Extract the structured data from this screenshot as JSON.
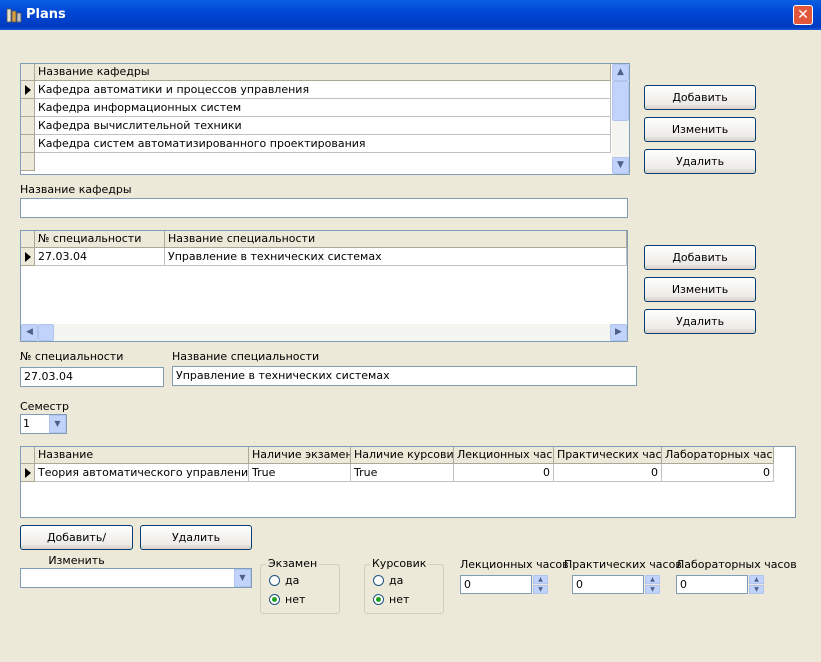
{
  "window": {
    "title": "Plans"
  },
  "departments_grid": {
    "column_header": "Название кафедры",
    "rows": [
      "Кафедра автоматики и процессов управления",
      "Кафедра информационных систем",
      "Кафедра вычислительной техники",
      "Кафедра систем автоматизированного проектирования"
    ]
  },
  "dept_buttons": {
    "add": "Добавить",
    "edit": "Изменить",
    "delete": "Удалить"
  },
  "dept_name": {
    "label": "Название кафедры",
    "value": ""
  },
  "specialties_grid": {
    "headers": [
      "№ специальности",
      "Название специальности"
    ],
    "rows": [
      [
        "27.03.04",
        "Управление в технических системах"
      ]
    ]
  },
  "spec_buttons": {
    "add": "Добавить",
    "edit": "Изменить",
    "delete": "Удалить"
  },
  "spec_number": {
    "label": "№ специальности",
    "value": "27.03.04"
  },
  "spec_name": {
    "label": "Название специальности",
    "value": "Управление в технических системах"
  },
  "semester": {
    "label": "Семестр",
    "value": "1"
  },
  "subjects_grid": {
    "headers": [
      "Название",
      "Наличие экзамена",
      "Наличие курсовика",
      "Лекционных часов",
      "Практических часов",
      "Лабораторных часов"
    ],
    "rows": [
      [
        "Теория автоматического управления",
        "True",
        "True",
        "0",
        "0",
        "0"
      ]
    ]
  },
  "subject_buttons": {
    "add_edit": "Добавить/Изменить",
    "delete": "Удалить"
  },
  "subject_combo": {
    "value": ""
  },
  "exam_group": {
    "title": "Экзамен",
    "yes": "да",
    "no": "нет",
    "selected": "нет"
  },
  "course_group": {
    "title": "Курсовик",
    "yes": "да",
    "no": "нет",
    "selected": "нет"
  },
  "hours": {
    "lecture": {
      "label": "Лекционных часов",
      "value": "0"
    },
    "practice": {
      "label": "Практических часов",
      "value": "0"
    },
    "lab": {
      "label": "Лабораторных часов",
      "value": "0"
    }
  }
}
